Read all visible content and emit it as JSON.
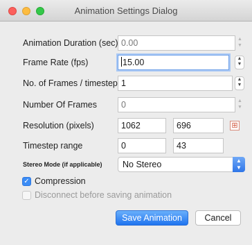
{
  "window": {
    "title": "Animation Settings Dialog"
  },
  "form": {
    "duration": {
      "label": "Animation Duration (sec)",
      "value": "0.00"
    },
    "frame_rate": {
      "label": "Frame Rate (fps)",
      "value": "15.00"
    },
    "frames_per_timestep": {
      "label": "No. of Frames / timestep",
      "value": "1"
    },
    "number_of_frames": {
      "label": "Number Of Frames",
      "value": "0"
    },
    "resolution": {
      "label": "Resolution (pixels)",
      "width": "1062",
      "height": "696"
    },
    "timestep_range": {
      "label": "Timestep range",
      "start": "0",
      "end": "43"
    },
    "stereo_mode": {
      "label": "Stereo Mode (if applicable)",
      "selected": "No Stereo"
    },
    "compression": {
      "label": "Compression",
      "checked": true
    },
    "disconnect": {
      "label": "Disconnect before saving animation",
      "checked": false,
      "enabled": false
    }
  },
  "buttons": {
    "save": "Save Animation",
    "cancel": "Cancel"
  },
  "colors": {
    "accent": "#3b8cf5",
    "close": "#fc605c",
    "minimize": "#fdbc40",
    "maximize": "#34c84a"
  }
}
